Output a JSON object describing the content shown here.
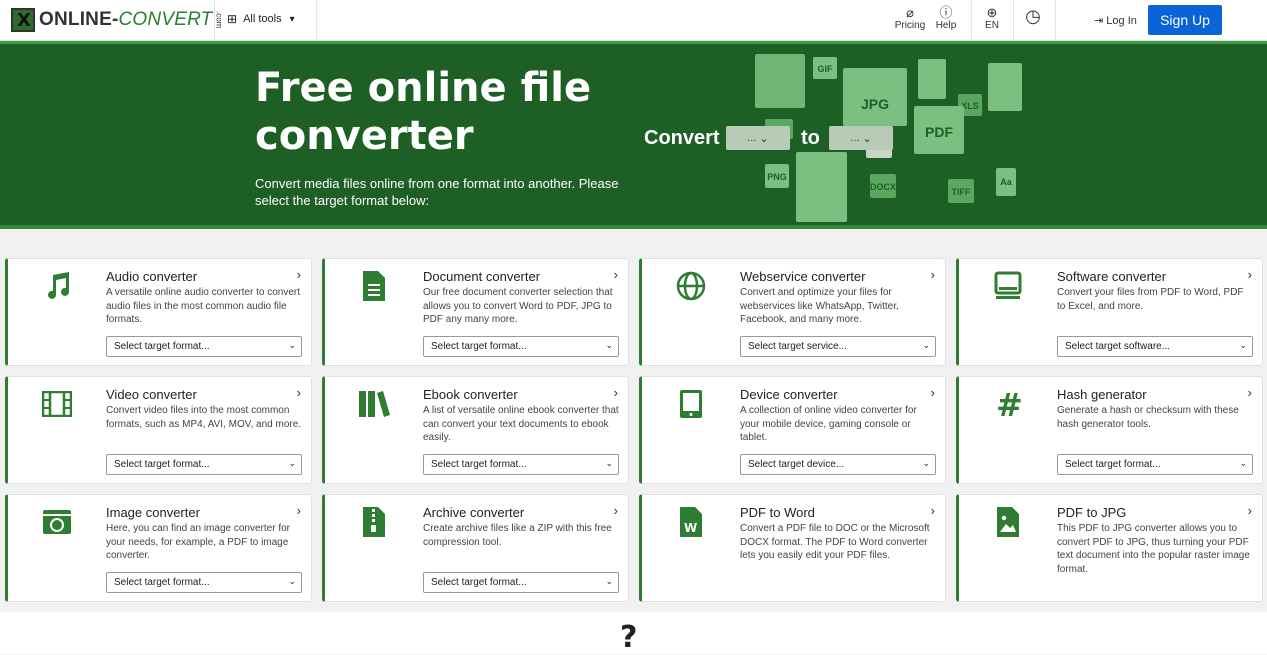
{
  "header": {
    "logo_text": "ONLINE-",
    "logo_accent": "CONVERT",
    "logo_com": ".com",
    "all_tools": "All tools",
    "pricing": "Pricing",
    "help": "Help",
    "language": "EN",
    "login": "Log In",
    "signup": "Sign Up"
  },
  "hero": {
    "title": "Free online file converter",
    "subtitle": "Convert media files online from one format into another. Please select the target format below:",
    "convert_label": "Convert",
    "to_label": "to",
    "from_select": "...",
    "to_select": "...",
    "file_labels": [
      "GIF",
      "JPG",
      "XLS",
      "PDF",
      "PNG",
      "DOCX",
      "TIFF",
      "Aa"
    ]
  },
  "cards": [
    {
      "title": "Audio converter",
      "desc": "A versatile online audio converter to convert audio files in the most common audio file formats.",
      "select": "Select target format...",
      "icon": "music-note-icon"
    },
    {
      "title": "Document converter",
      "desc": "Our free document converter selection that allows you to convert Word to PDF, JPG to PDF any many more.",
      "select": "Select target format...",
      "icon": "document-icon"
    },
    {
      "title": "Webservice converter",
      "desc": "Convert and optimize your files for webservices like WhatsApp, Twitter, Facebook, and many more.",
      "select": "Select target service...",
      "icon": "globe-icon"
    },
    {
      "title": "Software converter",
      "desc": "Convert your files from PDF to Word, PDF to Excel, and more.",
      "select": "Select target software...",
      "icon": "monitor-icon"
    },
    {
      "title": "Video converter",
      "desc": "Convert video files into the most common formats, such as MP4, AVI, MOV, and more.",
      "select": "Select target format...",
      "icon": "film-icon"
    },
    {
      "title": "Ebook converter",
      "desc": "A list of versatile online ebook converter that can convert your text documents to ebook easily.",
      "select": "Select target format...",
      "icon": "books-icon"
    },
    {
      "title": "Device converter",
      "desc": "A collection of online video converter for your mobile device, gaming console or tablet.",
      "select": "Select target device...",
      "icon": "tablet-icon"
    },
    {
      "title": "Hash generator",
      "desc": "Generate a hash or checksum with these hash generator tools.",
      "select": "Select target format...",
      "icon": "hash-icon"
    },
    {
      "title": "Image converter",
      "desc": "Here, you can find an image converter for your needs, for example, a PDF to image converter.",
      "select": "Select target format...",
      "icon": "camera-icon"
    },
    {
      "title": "Archive converter",
      "desc": "Create archive files like a ZIP with this free compression tool.",
      "select": "Select target format...",
      "icon": "archive-icon"
    },
    {
      "title": "PDF to Word",
      "desc": "Convert a PDF file to DOC or the Microsoft DOCX format. The PDF to Word converter lets you easily edit your PDF files.",
      "icon": "word-file-icon"
    },
    {
      "title": "PDF to JPG",
      "desc": "This PDF to JPG converter allows you to convert PDF to JPG, thus turning your PDF text document into the popular raster image format.",
      "icon": "image-file-icon"
    }
  ],
  "footer": {
    "question": "?"
  },
  "colors": {
    "brand_green": "#1e5f26",
    "accent_green": "#2e7d32",
    "signup_blue": "#0a64d8"
  }
}
